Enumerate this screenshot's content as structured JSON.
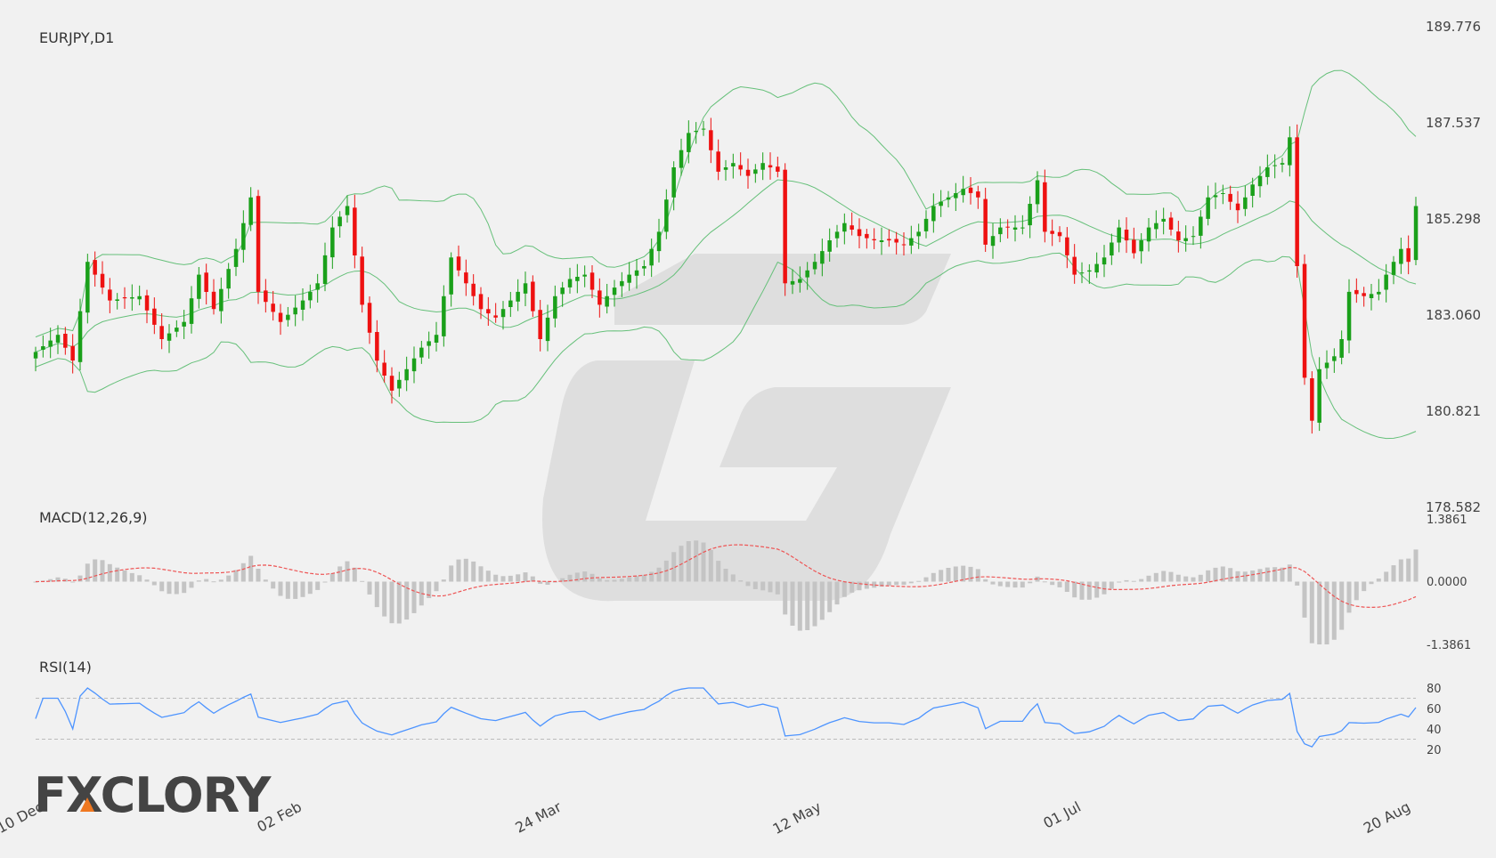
{
  "colors": {
    "background": "#f1f1f1",
    "bull": "#1aa01a",
    "bear": "#ee1111",
    "bollinger": "#66c07a",
    "macd_signal": "#ee5555",
    "macd_hist": "#c4c4c4",
    "rsi": "#4d94ff",
    "rsi_levels": "#bbbbbb",
    "text": "#444444",
    "watermark": "#dedede",
    "logo": "#444444",
    "logo_accent": "#f07820"
  },
  "logo": {
    "text": "FXCLORY"
  },
  "chart_data": [
    {
      "type": "candlestick",
      "title": "EURJPY,D1",
      "y_ticks": [
        "189.776",
        "187.537",
        "185.298",
        "183.060",
        "180.821",
        "178.582"
      ],
      "ylim": [
        178.582,
        189.776
      ],
      "x_ticks": [
        "10 Dec",
        "02 Feb",
        "24 Mar",
        "12 May",
        "01 Jul",
        "20 Aug"
      ],
      "x_tick_bar_index": [
        0,
        36,
        71,
        106,
        141,
        176
      ],
      "overlays": [
        "bollinger_bands"
      ],
      "waypoints": [
        [
          0,
          182.2
        ],
        [
          3,
          182.6
        ],
        [
          5,
          182.0
        ],
        [
          7,
          184.3
        ],
        [
          10,
          183.4
        ],
        [
          14,
          183.5
        ],
        [
          17,
          182.5
        ],
        [
          20,
          182.9
        ],
        [
          22,
          184.0
        ],
        [
          24,
          183.2
        ],
        [
          27,
          184.6
        ],
        [
          29,
          185.8
        ],
        [
          30,
          183.6
        ],
        [
          33,
          182.9
        ],
        [
          36,
          183.4
        ],
        [
          38,
          183.8
        ],
        [
          40,
          185.1
        ],
        [
          42,
          185.6
        ],
        [
          44,
          183.3
        ],
        [
          46,
          182.0
        ],
        [
          48,
          181.3
        ],
        [
          50,
          181.8
        ],
        [
          52,
          182.3
        ],
        [
          54,
          182.6
        ],
        [
          56,
          184.4
        ],
        [
          58,
          183.8
        ],
        [
          60,
          183.2
        ],
        [
          62,
          183.0
        ],
        [
          64,
          183.4
        ],
        [
          66,
          183.8
        ],
        [
          68,
          182.5
        ],
        [
          70,
          183.5
        ],
        [
          72,
          183.9
        ],
        [
          74,
          184.0
        ],
        [
          76,
          183.3
        ],
        [
          78,
          183.7
        ],
        [
          80,
          184.0
        ],
        [
          82,
          184.2
        ],
        [
          84,
          185.0
        ],
        [
          86,
          186.5
        ],
        [
          88,
          187.3
        ],
        [
          90,
          187.4
        ],
        [
          92,
          186.4
        ],
        [
          94,
          186.6
        ],
        [
          96,
          186.3
        ],
        [
          98,
          186.6
        ],
        [
          100,
          186.4
        ],
        [
          101,
          183.8
        ],
        [
          103,
          183.9
        ],
        [
          105,
          184.3
        ],
        [
          107,
          184.8
        ],
        [
          109,
          185.2
        ],
        [
          111,
          184.9
        ],
        [
          113,
          184.8
        ],
        [
          115,
          184.8
        ],
        [
          117,
          184.7
        ],
        [
          119,
          185.0
        ],
        [
          121,
          185.6
        ],
        [
          123,
          185.8
        ],
        [
          125,
          186.0
        ],
        [
          127,
          185.8
        ],
        [
          128,
          184.7
        ],
        [
          130,
          185.1
        ],
        [
          133,
          185.1
        ],
        [
          135,
          186.2
        ],
        [
          136,
          185.0
        ],
        [
          138,
          184.9
        ],
        [
          140,
          184.0
        ],
        [
          142,
          184.1
        ],
        [
          144,
          184.4
        ],
        [
          146,
          185.1
        ],
        [
          148,
          184.5
        ],
        [
          150,
          185.1
        ],
        [
          152,
          185.3
        ],
        [
          154,
          184.8
        ],
        [
          156,
          184.9
        ],
        [
          158,
          185.8
        ],
        [
          160,
          185.9
        ],
        [
          162,
          185.5
        ],
        [
          164,
          186.1
        ],
        [
          166,
          186.5
        ],
        [
          168,
          186.6
        ],
        [
          169,
          187.2
        ],
        [
          170,
          184.2
        ],
        [
          171,
          181.6
        ],
        [
          172,
          180.6
        ],
        [
          173,
          181.8
        ],
        [
          175,
          182.1
        ],
        [
          176,
          182.5
        ],
        [
          177,
          183.6
        ],
        [
          179,
          183.5
        ],
        [
          181,
          183.6
        ],
        [
          182,
          184.0
        ],
        [
          184,
          184.6
        ],
        [
          185,
          184.3
        ],
        [
          186,
          185.6
        ]
      ],
      "rsi": {
        "title": "RSI(14)",
        "y_ticks": [
          "80",
          "60",
          "40",
          "20"
        ],
        "ylim": [
          20,
          80
        ],
        "levels": [
          70,
          30
        ]
      },
      "macd": {
        "title": "MACD(12,26,9)",
        "y_ticks": [
          "1.3861",
          "0.0000",
          "-1.3861"
        ],
        "ylim": [
          -1.3861,
          1.3861
        ]
      }
    }
  ]
}
